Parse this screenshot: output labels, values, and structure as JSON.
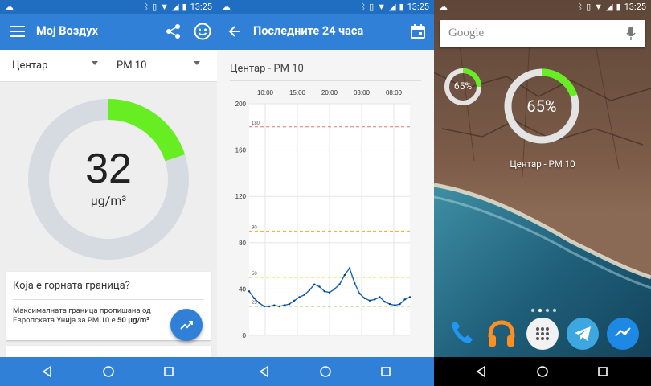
{
  "status": {
    "time": "13:25"
  },
  "screen1": {
    "title": "Мој Воздух",
    "location": "Центар",
    "pollutant": "PM 10",
    "gauge_value": "32",
    "gauge_unit": "µg/m³",
    "gauge_fraction": 0.2,
    "card_title": "Која е горната граница?",
    "card_text": "Максималната граница пропишана од Европската Унија за PM 10 е ",
    "card_text_bold": "50 µg/m³",
    "card_text_end": "."
  },
  "screen2": {
    "title": "Последните 24 часа",
    "subtitle": "Центар - PM 10"
  },
  "chart_data": {
    "type": "line",
    "title": "",
    "x_ticks": [
      "10:00",
      "15:00",
      "20:00",
      "03:00",
      "08:00"
    ],
    "y_ticks": [
      0,
      40,
      80,
      120,
      160,
      200
    ],
    "ylim": [
      0,
      200
    ],
    "thresholds": [
      {
        "value": 180,
        "label": "180",
        "color": "#e57373"
      },
      {
        "value": 90,
        "label": "90",
        "color": "#f0a830"
      },
      {
        "value": 50,
        "label": "50",
        "color": "#f5d040"
      },
      {
        "value": 25,
        "label": "25",
        "color": "#9ccc65"
      }
    ],
    "series": [
      {
        "values": [
          38,
          32,
          28,
          25,
          25,
          26,
          25,
          26,
          27,
          30,
          33,
          35,
          39,
          44,
          42,
          38,
          37,
          40,
          44,
          52,
          58,
          45,
          36,
          32,
          30,
          31,
          33,
          29,
          27,
          26,
          27,
          31,
          33
        ],
        "color": "#1565c0"
      }
    ]
  },
  "screen3": {
    "search_placeholder": "Google",
    "small_widget_value": "65%",
    "small_widget_fraction": 0.25,
    "big_widget_value": "65%",
    "big_widget_fraction": 0.2,
    "widget_label": "Центар - PM 10"
  }
}
